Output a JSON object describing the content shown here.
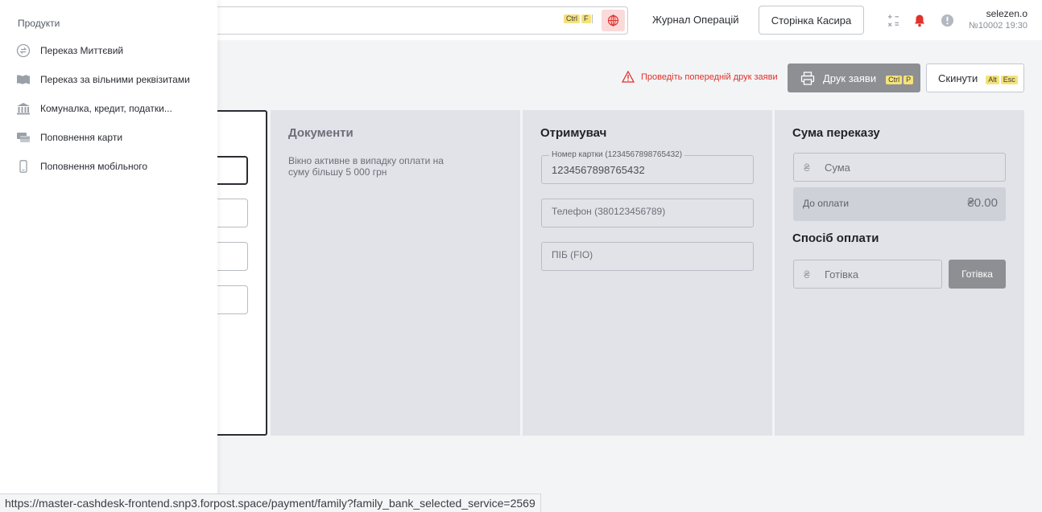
{
  "header": {
    "search_shortcut": [
      "Ctrl",
      "F"
    ],
    "operations_log_link": "Журнал Операцій",
    "cashier_page_button": "Сторінка Касира",
    "user_name": "selezen.o",
    "user_meta": "№10002 19:30"
  },
  "actions": {
    "warning_text": "Проведіть попередній друк заяви",
    "print_label": "Друк заяви",
    "print_shortcut": [
      "Ctrl",
      "P"
    ],
    "reset_label": "Скинути",
    "reset_shortcut": [
      "Alt",
      "Esc"
    ]
  },
  "documents": {
    "title": "Документи",
    "text": "Вікно активне в випадку оплати на суму більшу 5 000 грн"
  },
  "recipient": {
    "title": "Отримувач",
    "card_legend": "Номер картки (1234567898765432)",
    "card_value": "1234567898765432",
    "phone_placeholder": "Телефон (380123456789)",
    "name_placeholder": "ПІБ (FIO)"
  },
  "transfer_sum": {
    "title": "Сума переказу",
    "currency_symbol": "₴",
    "sum_placeholder": "Сума",
    "due_label": "До оплати",
    "due_amount": "₴0.00",
    "payment_method_title": "Спосіб оплати",
    "payment_method_value": "Готівка",
    "payment_method_button": "Готівка"
  },
  "sidebar": {
    "title": "Продукти",
    "items": [
      {
        "label": "Переказ Миттєвий",
        "icon": "instant-transfer-icon"
      },
      {
        "label": "Переказ за вільними реквізитами",
        "icon": "flag-icon"
      },
      {
        "label": "Комуналка, кредит, податки...",
        "icon": "bank-icon"
      },
      {
        "label": "Поповнення карти",
        "icon": "card-icon"
      },
      {
        "label": "Поповнення мобільного",
        "icon": "mobile-icon"
      }
    ]
  },
  "status_bar": {
    "url": "https://master-cashdesk-frontend.snp3.forpost.space/payment/family?family_bank_selected_service=2569"
  },
  "colors": {
    "accent_red": "#e0312b",
    "button_gray": "#8d8f93",
    "panel_bg": "#e2e3e8",
    "shortcut_yellow": "#f5e27a"
  }
}
